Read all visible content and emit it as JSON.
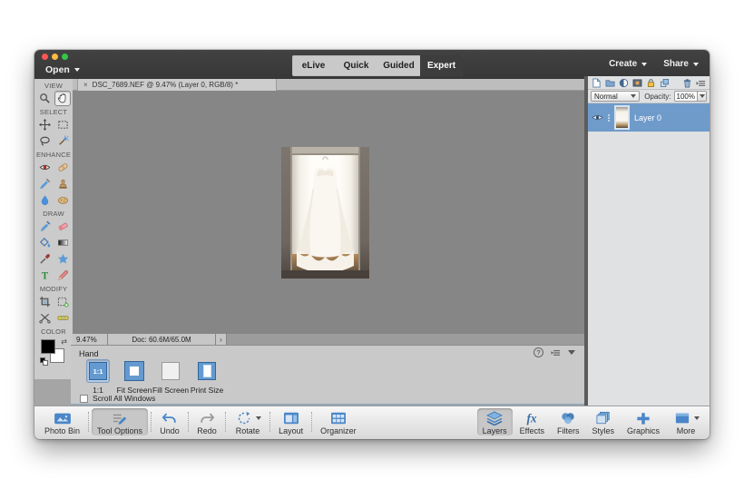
{
  "menubar": {
    "open_label": "Open",
    "mode_tabs": [
      {
        "label": "eLive",
        "active": false
      },
      {
        "label": "Quick",
        "active": false
      },
      {
        "label": "Guided",
        "active": false
      },
      {
        "label": "Expert",
        "active": true
      }
    ],
    "create_label": "Create",
    "share_label": "Share"
  },
  "document_tab": {
    "close_glyph": "×",
    "title": "DSC_7689.NEF @ 9.47% (Layer 0, RGB/8) *"
  },
  "toolbox": {
    "sections": [
      {
        "label": "VIEW",
        "tools": [
          {
            "name": "zoom-tool",
            "selected": false
          },
          {
            "name": "hand-tool",
            "selected": true
          }
        ]
      },
      {
        "label": "SELECT",
        "tools": [
          {
            "name": "move-tool",
            "selected": false
          },
          {
            "name": "marquee-tool",
            "selected": false
          },
          {
            "name": "lasso-tool",
            "selected": false
          },
          {
            "name": "quick-selection-tool",
            "selected": false
          }
        ]
      },
      {
        "label": "ENHANCE",
        "tools": [
          {
            "name": "red-eye-tool",
            "selected": false
          },
          {
            "name": "spot-healing-tool",
            "selected": false
          },
          {
            "name": "smart-brush-tool",
            "selected": false
          },
          {
            "name": "clone-stamp-tool",
            "selected": false
          },
          {
            "name": "blur-tool",
            "selected": false
          },
          {
            "name": "sponge-tool",
            "selected": false
          }
        ]
      },
      {
        "label": "DRAW",
        "tools": [
          {
            "name": "brush-tool",
            "selected": false
          },
          {
            "name": "eraser-tool",
            "selected": false
          },
          {
            "name": "paint-bucket-tool",
            "selected": false
          },
          {
            "name": "gradient-tool",
            "selected": false
          },
          {
            "name": "eyedropper-tool",
            "selected": false
          },
          {
            "name": "shape-tool",
            "selected": false
          },
          {
            "name": "type-tool",
            "selected": false
          },
          {
            "name": "pencil-tool",
            "selected": false
          }
        ]
      },
      {
        "label": "MODIFY",
        "tools": [
          {
            "name": "crop-tool",
            "selected": false
          },
          {
            "name": "recompose-tool",
            "selected": false
          },
          {
            "name": "content-aware-move-tool",
            "selected": false
          },
          {
            "name": "straighten-tool",
            "selected": false
          }
        ]
      },
      {
        "label": "COLOR",
        "tools": []
      }
    ],
    "foreground_color": "#000000",
    "background_color": "#ffffff"
  },
  "statusbar": {
    "zoom_level": "9.47%",
    "doc_size": "Doc: 60.6M/65.0M",
    "disclosure_glyph": "›"
  },
  "tool_options": {
    "title": "Hand",
    "help_glyph": "?",
    "buttons": [
      {
        "label": "1:1",
        "icon": "one-to-one",
        "selected": true
      },
      {
        "label": "Fit Screen",
        "icon": "fit-screen",
        "selected": false
      },
      {
        "label": "Fill Screen",
        "icon": "fill-screen",
        "selected": false
      },
      {
        "label": "Print Size",
        "icon": "print-size",
        "selected": false
      }
    ],
    "checkbox_label": "Scroll All Windows",
    "checkbox_checked": false
  },
  "layers_panel": {
    "header_icons_left": [
      "new-layer",
      "new-group",
      "adjustment-layer",
      "layer-mask",
      "lock",
      "link-layers"
    ],
    "header_icons_right": [
      "delete-layer",
      "panel-menu"
    ],
    "blend_mode": "Normal",
    "opacity_label": "Opacity:",
    "opacity_value": "100%",
    "layers": [
      {
        "name": "Layer 0",
        "visible": true,
        "selected": true
      }
    ]
  },
  "taskbar": {
    "left": [
      {
        "label": "Photo Bin",
        "icon": "photo-bin",
        "active": false,
        "dropdown": false
      },
      {
        "label": "Tool Options",
        "icon": "tool-options",
        "active": true,
        "dropdown": false
      },
      {
        "label": "Undo",
        "icon": "undo",
        "active": false,
        "dropdown": false
      },
      {
        "label": "Redo",
        "icon": "redo",
        "active": false,
        "dropdown": false
      },
      {
        "label": "Rotate",
        "icon": "rotate",
        "active": false,
        "dropdown": true
      },
      {
        "label": "Layout",
        "icon": "layout",
        "active": false,
        "dropdown": false
      },
      {
        "label": "Organizer",
        "icon": "organizer",
        "active": false,
        "dropdown": false
      }
    ],
    "right": [
      {
        "label": "Layers",
        "icon": "layers",
        "active": true,
        "dropdown": false
      },
      {
        "label": "Effects",
        "icon": "effects",
        "active": false,
        "dropdown": false
      },
      {
        "label": "Filters",
        "icon": "filters",
        "active": false,
        "dropdown": false
      },
      {
        "label": "Styles",
        "icon": "styles",
        "active": false,
        "dropdown": false
      },
      {
        "label": "Graphics",
        "icon": "graphics",
        "active": false,
        "dropdown": false
      },
      {
        "label": "More",
        "icon": "more",
        "active": false,
        "dropdown": true
      }
    ]
  },
  "colors": {
    "header_dark": "#3a3a3a",
    "canvas_gray": "#868686",
    "panel_light": "#dfe1e3",
    "selected_layer_blue": "#6f9bcb",
    "accent_blue": "#649ad0"
  }
}
